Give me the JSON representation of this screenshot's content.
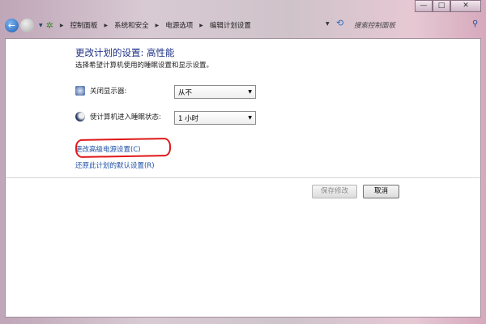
{
  "window": {
    "minimize": "—",
    "maximize": "□",
    "close": "✕"
  },
  "address": {
    "crumbs": [
      "控制面板",
      "系统和安全",
      "电源选项",
      "编辑计划设置"
    ],
    "search_placeholder": "搜索控制面板"
  },
  "main": {
    "title": "更改计划的设置: 高性能",
    "subtitle": "选择希望计算机使用的睡眠设置和显示设置。",
    "settings": [
      {
        "label": "关闭显示器:",
        "value": "从不"
      },
      {
        "label": "使计算机进入睡眠状态:",
        "value": "1 小时"
      }
    ],
    "links": [
      "更改高级电源设置(C)",
      "还原此计划的默认设置(R)"
    ],
    "save_label": "保存修改",
    "cancel_label": "取消"
  },
  "annotation_color": "#e01818"
}
